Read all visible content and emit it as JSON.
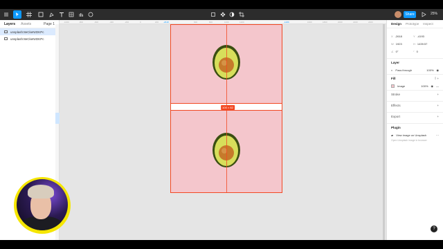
{
  "toolbar": {
    "share_label": "Share",
    "zoom": "25%"
  },
  "left_panel": {
    "tabs": [
      "Layers",
      "Assets"
    ],
    "page": "Page 1",
    "layers": [
      {
        "name": "unsplash:8eCkeNrDKPc",
        "selected": true
      },
      {
        "name": "unsplash:8eCkeNrDKPc",
        "selected": false
      }
    ]
  },
  "ruler": {
    "ticks": [
      "-1000",
      "-800",
      "-600",
      "-400",
      "-200",
      "0",
      "200",
      "400",
      "600",
      "800",
      "1000",
      "1200",
      "1400",
      "1600",
      "1800",
      "2000",
      "2200",
      "2400"
    ],
    "highlight_start": "-2618",
    "highlight_end": "-1266"
  },
  "canvas": {
    "dimension_label": "100 × 82"
  },
  "right_panel": {
    "tabs": [
      "Design",
      "Prototype",
      "Inspect"
    ],
    "x": "-2618",
    "y": "-4193",
    "w": "1923",
    "h": "1439.57",
    "rotation": "0°",
    "radius": "0",
    "layer_section": "Layer",
    "layer_mode": "Pass through",
    "layer_opacity": "100%",
    "fill_section": "Fill",
    "fill_type": "Image",
    "fill_opacity": "100%",
    "stroke_section": "Stroke",
    "effects_section": "Effects",
    "export_section": "Export",
    "plugin_section": "Plugin",
    "plugin_name": "View image on Unsplash",
    "plugin_hint": "Open Unsplash image in browser"
  },
  "colors": {
    "accent": "#0d99ff",
    "selection": "#f24822",
    "pink": "#f4c6cc"
  }
}
